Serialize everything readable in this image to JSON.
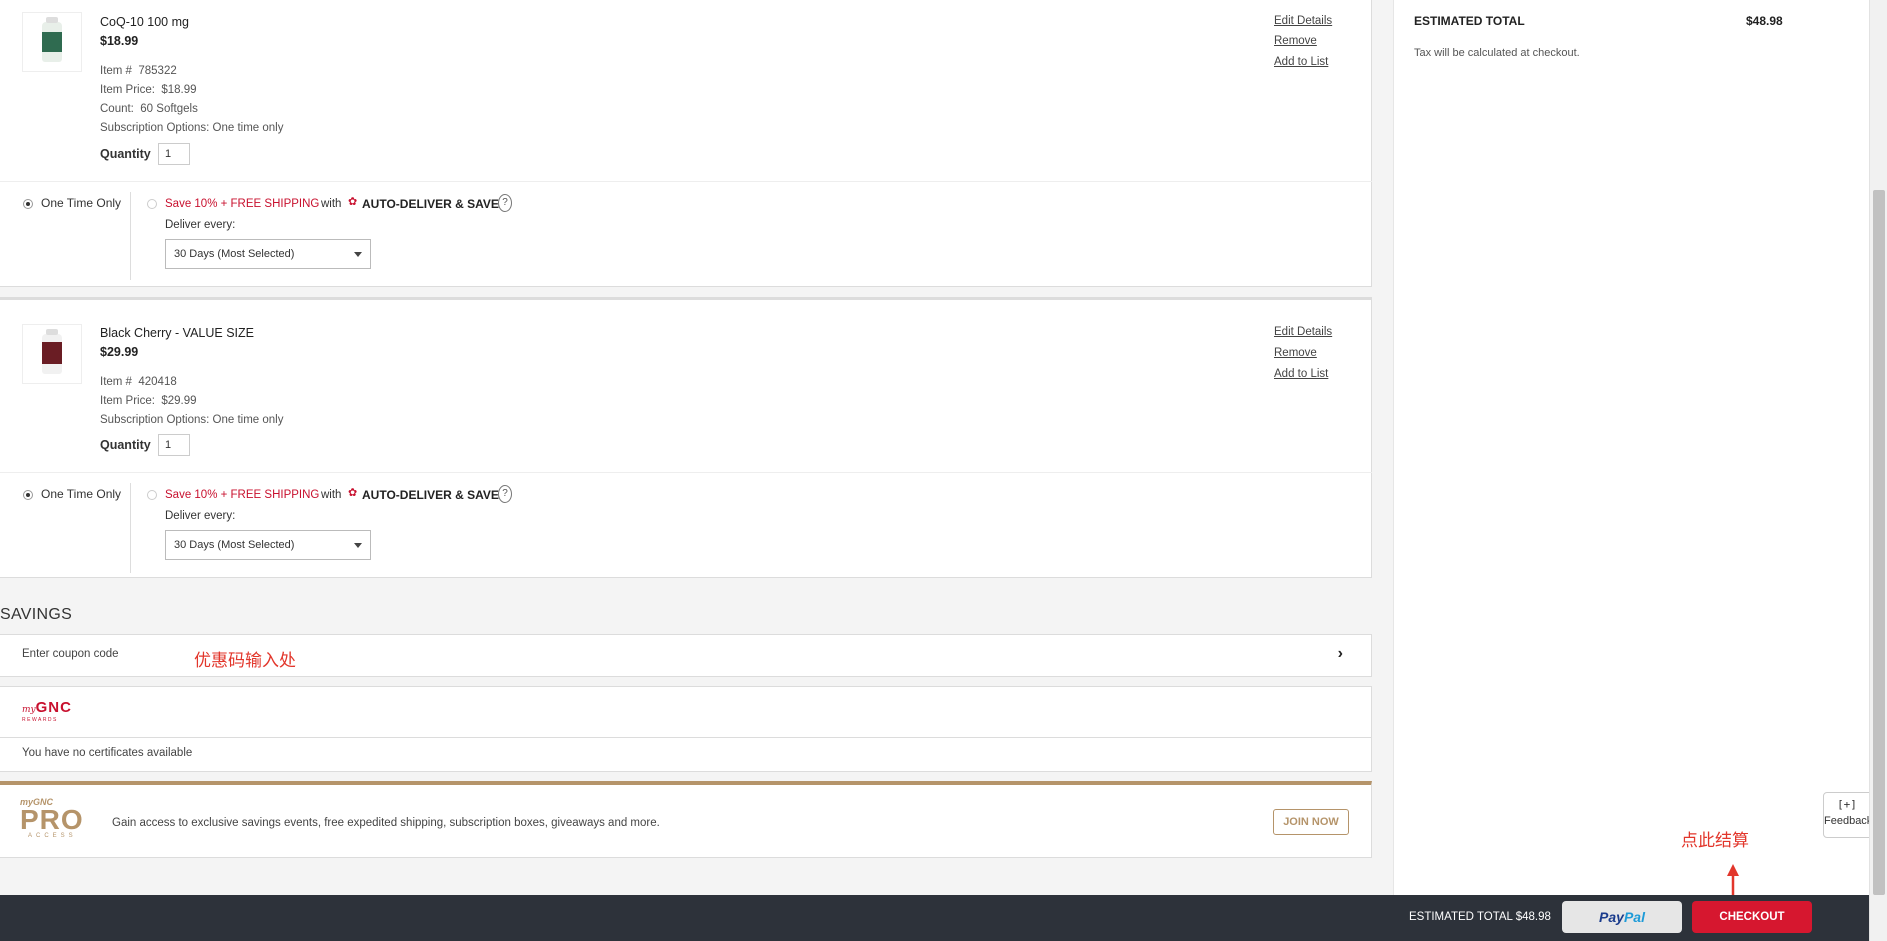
{
  "cart": {
    "items": [
      {
        "name": "CoQ-10 100 mg",
        "price": "$18.99",
        "item_no_label": "Item #",
        "item_no": "785322",
        "item_price_label": "Item Price:",
        "item_price": "$18.99",
        "count_label": "Count:",
        "count": "60 Softgels",
        "subscription_label": "Subscription Options:",
        "subscription": "One time only",
        "quantity_label": "Quantity",
        "quantity": "1",
        "actions": [
          "Edit Details",
          "Remove",
          "Add to List"
        ],
        "one_time_label": "One Time Only",
        "save_text": "Save 10% + FREE SHIPPING",
        "with_text": "with",
        "auto_deliver_text": "AUTO-DELIVER & SAVE",
        "help_icon": "?",
        "deliver_every_label": "Deliver every:",
        "deliver_every_value": "30 Days (Most Selected)"
      },
      {
        "name": "Black Cherry - VALUE SIZE",
        "price": "$29.99",
        "item_no_label": "Item #",
        "item_no": "420418",
        "item_price_label": "Item Price:",
        "item_price": "$29.99",
        "subscription_label": "Subscription Options:",
        "subscription": "One time only",
        "quantity_label": "Quantity",
        "quantity": "1",
        "actions": [
          "Edit Details",
          "Remove",
          "Add to List"
        ],
        "one_time_label": "One Time Only",
        "save_text": "Save 10% + FREE SHIPPING",
        "with_text": "with",
        "auto_deliver_text": "AUTO-DELIVER & SAVE",
        "help_icon": "?",
        "deliver_every_label": "Deliver every:",
        "deliver_every_value": "30 Days (Most Selected)"
      }
    ]
  },
  "savings": {
    "title": "SAVINGS",
    "coupon_placeholder": "Enter coupon code",
    "coupon_annotation": "优惠码输入处",
    "rewards_logo_my": "my",
    "rewards_logo_gnc": "GNC",
    "rewards_logo_sub": "REWARDS",
    "no_certificates": "You have no certificates available"
  },
  "pro_access": {
    "logo_mygnc": "myGNC",
    "logo_pro": "PRO",
    "logo_access": "ACCESS",
    "text": "Gain access to exclusive savings events, free expedited shipping, subscription boxes, giveaways and more.",
    "join_label": "JOIN NOW"
  },
  "summary": {
    "estimated_total_label": "ESTIMATED TOTAL",
    "estimated_total_value": "$48.98",
    "tax_note": "Tax will be calculated at checkout."
  },
  "feedback": {
    "icon": "[+]",
    "label": "Feedback"
  },
  "bottom_bar": {
    "total_text": "ESTIMATED TOTAL $48.98",
    "paypal_part1": "Pay",
    "paypal_part2": "Pal",
    "checkout_label": "CHECKOUT",
    "checkout_annotation": "点此结算"
  },
  "colors": {
    "brand_red": "#d6172f",
    "pro_gold": "#b5946a",
    "annotation_red": "#e2362b",
    "bottom_bar_bg": "#2d323a"
  }
}
